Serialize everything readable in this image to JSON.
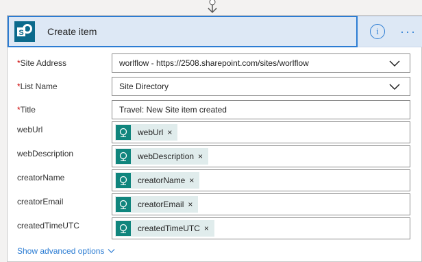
{
  "header": {
    "title": "Create item",
    "info_glyph": "i",
    "more_glyph": "···"
  },
  "fields": [
    {
      "label": "Site Address",
      "required": true,
      "value": "worlflow - https://2508.sharepoint.com/sites/worlflow",
      "kind": "dropdown"
    },
    {
      "label": "List Name",
      "required": true,
      "value": "Site Directory",
      "kind": "dropdown"
    },
    {
      "label": "Title",
      "required": true,
      "value": "Travel: New Site item created",
      "kind": "text"
    },
    {
      "label": "webUrl",
      "required": false,
      "value": "webUrl",
      "kind": "token"
    },
    {
      "label": "webDescription",
      "required": false,
      "value": "webDescription",
      "kind": "token"
    },
    {
      "label": "creatorName",
      "required": false,
      "value": "creatorName",
      "kind": "token"
    },
    {
      "label": "creatorEmail",
      "required": false,
      "value": "creatorEmail",
      "kind": "token"
    },
    {
      "label": "createdTimeUTC",
      "required": false,
      "value": "createdTimeUTC",
      "kind": "token"
    }
  ],
  "advanced": {
    "label": "Show advanced options"
  },
  "token_remove_glyph": "×",
  "required_marker": "*",
  "colors": {
    "accent": "#2b7cd3",
    "header_bg": "#dde8f5",
    "token_icon": "#10857d",
    "token_bg": "#e0ecec",
    "required": "#cc0000"
  }
}
